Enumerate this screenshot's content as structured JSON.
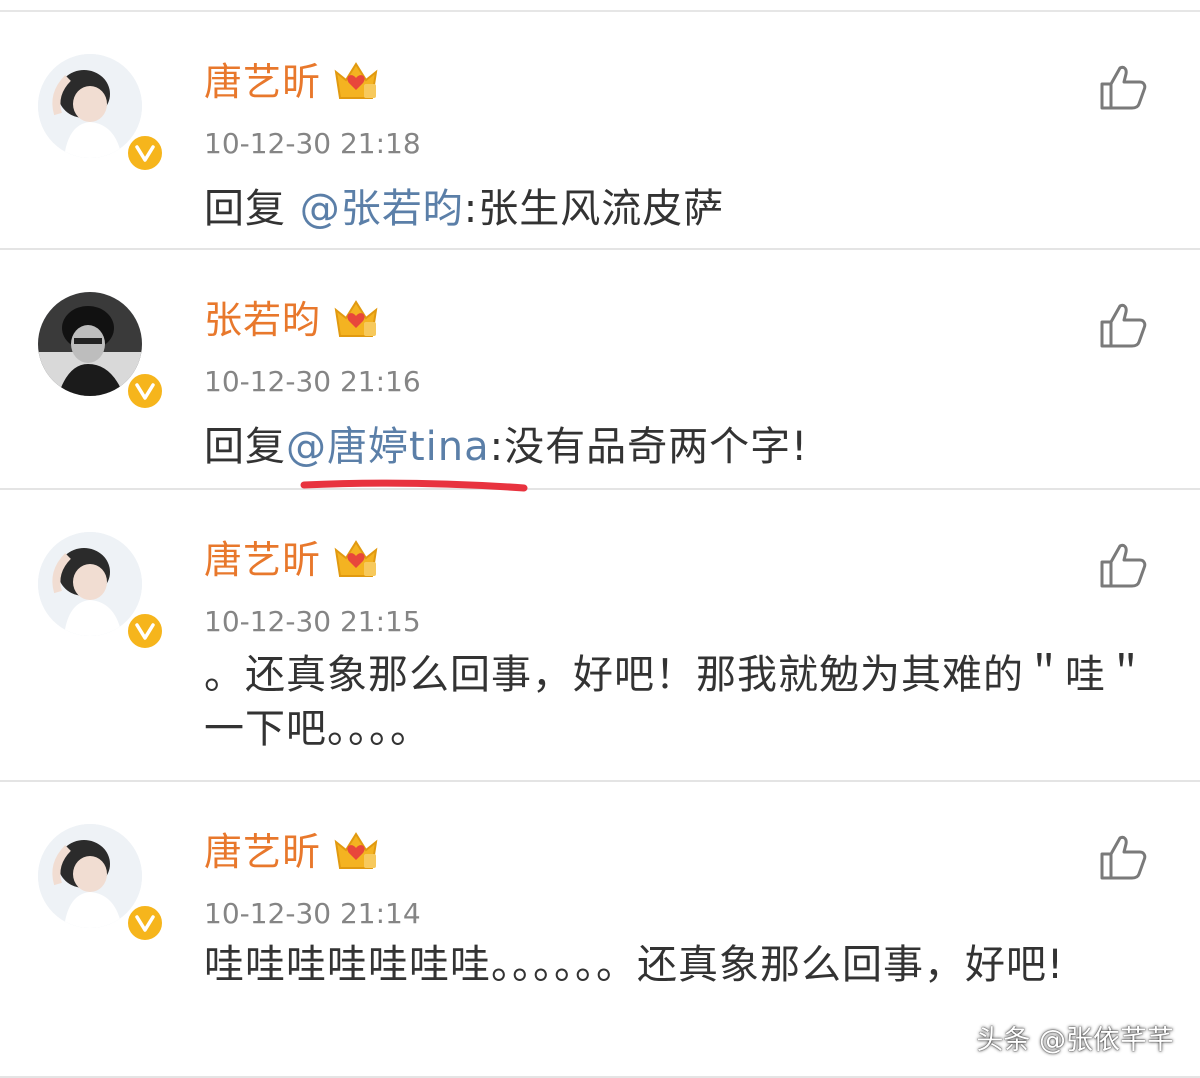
{
  "comments": [
    {
      "username": "唐艺昕",
      "timestamp": "10-12-30 21:18",
      "reply_prefix": "回复 ",
      "mention": "@张若昀",
      "body": ":张生风流皮萨"
    },
    {
      "username": "张若昀",
      "timestamp": "10-12-30 21:16",
      "reply_prefix": "回复",
      "mention": "@唐婷tina",
      "body": ":没有品奇两个字!"
    },
    {
      "username": "唐艺昕",
      "timestamp": "10-12-30 21:15",
      "reply_prefix": "",
      "mention": "",
      "body": "。还真象那么回事，好吧！那我就勉为其难的＂哇＂一下吧。。。。"
    },
    {
      "username": "唐艺昕",
      "timestamp": "10-12-30 21:14",
      "reply_prefix": "",
      "mention": "",
      "body": "哇哇哇哇哇哇哇。。。。。。还真象那么回事，好吧!"
    }
  ],
  "watermark": {
    "source": "头条 @张依芊芊"
  },
  "colors": {
    "username": "#e8782c",
    "mention": "#5b7fa8",
    "verified": "#f6b51c",
    "annotation_underline": "#e8333f"
  },
  "icons": {
    "like": "thumbs-up-icon",
    "verified": "verified-badge-icon",
    "vip": "crown-level-icon"
  }
}
